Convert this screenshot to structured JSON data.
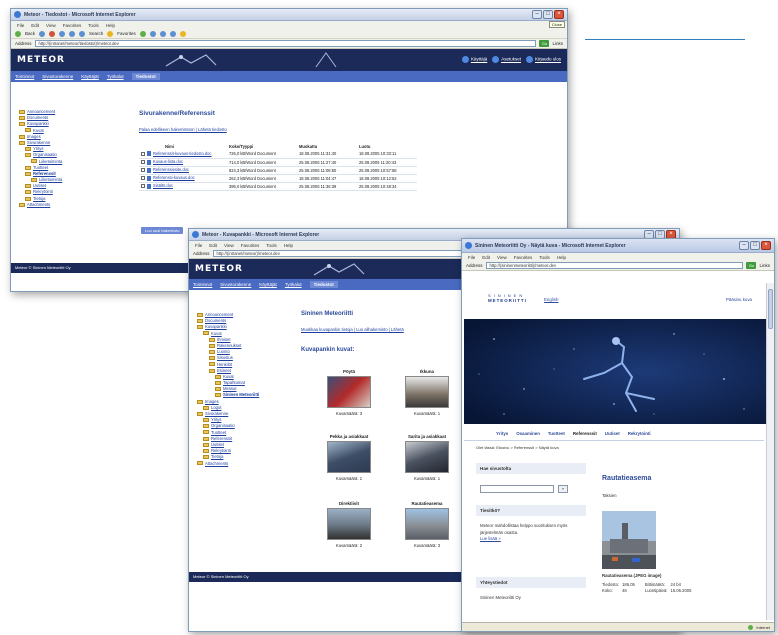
{
  "window1": {
    "title": "Meteor - Tiedostot - Microsoft Internet Explorer",
    "menu": [
      "File",
      "Edit",
      "View",
      "Favorites",
      "Tools",
      "Help"
    ],
    "toolbar": [
      "Back",
      "Search",
      "Favorites"
    ],
    "address_label": "Address",
    "address": "http://(intranet/meteor/tiedostot)/meteor.dev",
    "go": "Go",
    "links": "Links",
    "close_label": "Close",
    "header": {
      "logo": "METEOR",
      "links": [
        "Käyttäjä",
        "Asetukset",
        "Kirjaudu ulos"
      ]
    },
    "nav": [
      "Toiminnot",
      "Sivustorakenne",
      "Käyttäjät",
      "Työkalut",
      "Tiedostot"
    ],
    "tree": [
      "Announcement",
      "Documents",
      "Kuvapankki",
      "Kuvat",
      "Images",
      "Sivurakenne",
      "Yritys",
      "Organisaatio",
      "Liiketoiminta",
      "Tuotteet",
      "Referenssit",
      "Liiketoiminta",
      "Uutiset",
      "Rekrytointi",
      "Tietoja",
      "Attachments"
    ],
    "content_title": "Sivurakenne/Referenssit",
    "breadcrumb": "Palaa edelliseen hakemistoon | Lähetä tiedosto",
    "table_headers": [
      "Nimi",
      "Koko/Tyyppi",
      "Muokattu",
      "Luotu"
    ],
    "files": [
      [
        "Referenssit-kuvaus-tiedosto.doc",
        "726,0 kB/Word Document",
        "18.08.2005 11:31:40",
        "18.08.2005 10:33:11"
      ],
      [
        "Kuvaus-lista.doc",
        "714,0 kB/Word Document",
        "25.08.2005 11:27:40",
        "25.08.2005 11:20:43"
      ],
      [
        "Referenssiesite.doc",
        "824,3 kB/Word Document",
        "25.08.2005 11:08:50",
        "25.08.2005 10:57:58"
      ],
      [
        "Referenssi-kuvaus.doc",
        "262,3 kB/Word Document",
        "18.08.2005 11:04:47",
        "18.08.2005 10:12:52"
      ],
      [
        "Sisältö.doc",
        "395,0 kB/Word Document",
        "25.08.2005 11:36:39",
        "25.08.2005 10:48:34"
      ]
    ],
    "button": "Luo uusi hakemisto",
    "footer": "Meteor © Sininen Meteoriitti Oy"
  },
  "window2": {
    "title": "Meteor - Kuvapankki - Microsoft Internet Explorer",
    "menu": [
      "File",
      "Edit",
      "View",
      "Favorites",
      "Tools",
      "Help"
    ],
    "address_label": "Address",
    "address": "http://(intranet/meteor)/meteor.dev",
    "header": {
      "logo": "METEOR"
    },
    "nav": [
      "Toiminnot",
      "Sivustorakenne",
      "Käyttäjät",
      "Työkalut",
      "Tiedostot"
    ],
    "tree": [
      "Announcement",
      "Documents",
      "Kuvapankki",
      "Kuvat",
      "Ihmiset",
      "Rakennukset",
      "Luonto",
      "Sisustus",
      "Henkilöt",
      "Esineet",
      "Kuvat",
      "Tapahtumat",
      "Messut",
      "Sininen Meteoriitti",
      "Images",
      "Logot",
      "Sivurakenne",
      "Yritys",
      "Organisaatio",
      "Tuotteet",
      "Referenssit",
      "Uutiset",
      "Rekrytointi",
      "Tietoja",
      "Attachments"
    ],
    "site_title": "Sininen Meteoriitti",
    "breadcrumb": "Muokkaa kuvapankin tietoja | Luo alihakemisto | Lähetä",
    "gallery_title": "Kuvapankin kuvat:",
    "gallery": [
      {
        "title": "Pöytä",
        "sub": "Kuvamäärä: 3"
      },
      {
        "title": "Ikkuna",
        "sub": "Kuvamäärä: 1"
      },
      {
        "title": "Pekka ja asiakkaat",
        "sub": "Kuvamäärä: 1"
      },
      {
        "title": "Sarita ja asiakkaat",
        "sub": "Kuvamäärä: 1"
      },
      {
        "title": "Direktiivit",
        "sub": "Kuvamäärä: 2"
      },
      {
        "title": "Rautatieasema",
        "sub": "Kuvamäärä: 3"
      }
    ],
    "footer": "Meteor © Sininen Meteoriitti Oy"
  },
  "window3": {
    "title": "Sininen Meteoriitti Oy - Näytä kuva - Microsoft Internet Explorer",
    "menu": [
      "File",
      "Edit",
      "View",
      "Favorites",
      "Tools",
      "Help"
    ],
    "address_label": "Address",
    "address": "http://(sininenmeteoriitti)/meteor.dev",
    "go": "Go",
    "links": "Links",
    "logo_line1": "SININEN",
    "logo_line2": "METEORIITTI",
    "lang": "English",
    "home": "Pääsivu kuva",
    "nav": [
      "Yritys",
      "Osaaminen",
      "Tuotteet",
      "Referenssit",
      "Uutiset",
      "Rekrytointi"
    ],
    "breadcrumb": "Olet tässä: Etusivu > Referenssit > Näytä kuva",
    "search_title": "Hae sivustolta",
    "search_go": "»",
    "tip_title": "Tiesitkö?",
    "tip_text": "Meteor mahdollistaa helppo suorituksen myös järjestelmän osasta.",
    "tip_link": "Lue lisää »",
    "contact_title": "Yhteystiedot",
    "contact_text": "Sininen Meteoriitti Oy",
    "image_title": "Rautatieasema",
    "image_sub": "Taksien",
    "image_caption": "Rautatieasema (JPEG image)",
    "meta": [
      [
        "Tiedosto:",
        "186,05",
        "Bittimäärä:",
        "24 bit"
      ],
      [
        "Koko:",
        "48",
        "Luontipäivä:",
        "15.06.2005"
      ]
    ],
    "status": "Internet"
  },
  "colors": {
    "meteor_dark": "#1b2a59",
    "meteor_nav": "#4a6ac2",
    "sky": "#0d1f4a",
    "ie_title": "#c4d0e6"
  }
}
